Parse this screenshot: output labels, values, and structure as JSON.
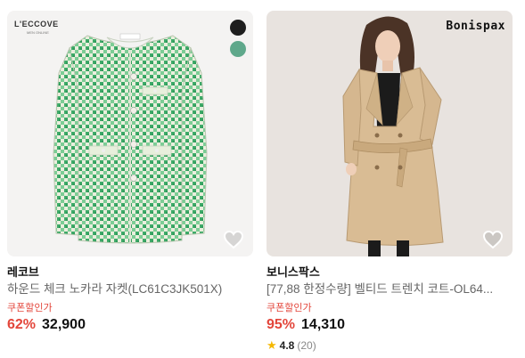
{
  "products": [
    {
      "logo_text": "L'ECCOVE",
      "logo_sub": "MEN ONLINE",
      "brand": "레코브",
      "name": "하운드 체크 노카라 자켓(LC61C3JK501X)",
      "coupon_label": "쿠폰할인가",
      "discount": "62%",
      "price": "32,900",
      "colors": [
        "#1e1e1e",
        "#5fa88b"
      ],
      "icons": [
        "heart-icon"
      ]
    },
    {
      "logo_text": "Bonispax",
      "brand": "보니스팍스",
      "name": "[77,88 한정수량] 벨티드 트렌치 코트-OL64...",
      "coupon_label": "쿠폰할인가",
      "discount": "95%",
      "price": "14,310",
      "rating": "4.8",
      "rating_count": "(20)",
      "icons": [
        "heart-icon",
        "star-icon"
      ]
    }
  ]
}
